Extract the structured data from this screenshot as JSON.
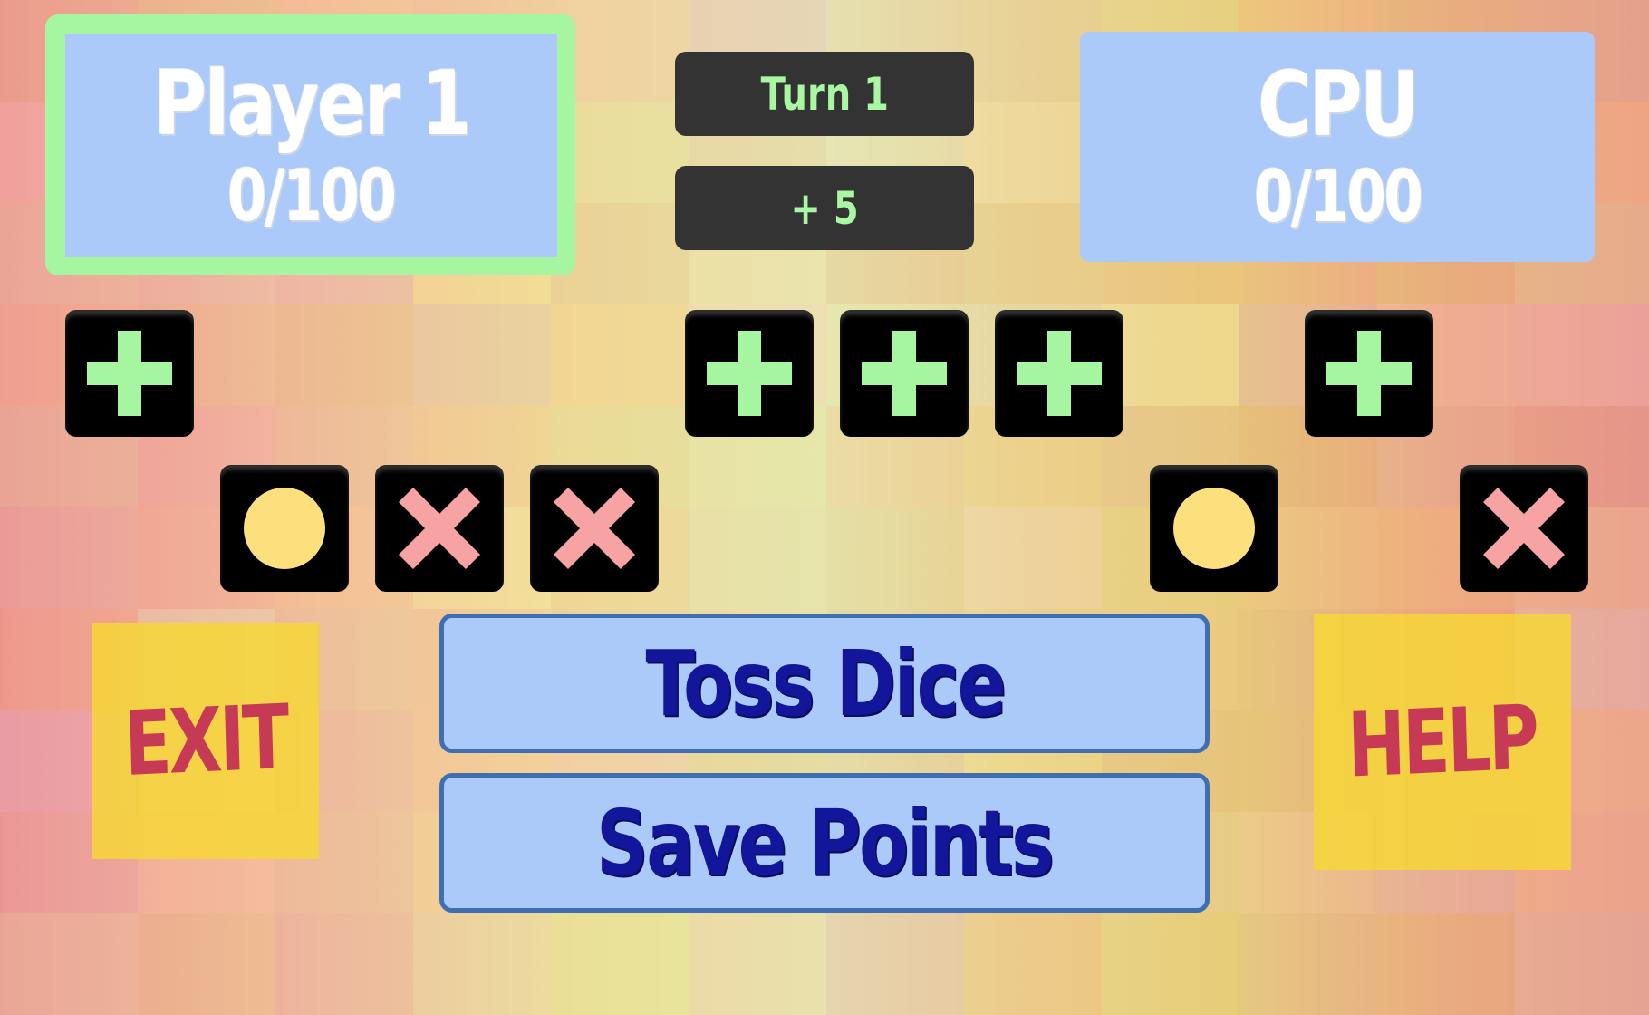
{
  "player": {
    "name": "Player 1",
    "score": "0/100",
    "active": true
  },
  "cpu": {
    "name": "CPU",
    "score": "0/100"
  },
  "turn_label": "Turn 1",
  "pending_points": "+ 5",
  "dice": [
    {
      "face": "plus",
      "row": "top"
    },
    {
      "face": "circle",
      "row": "bottom"
    },
    {
      "face": "cross",
      "row": "bottom"
    },
    {
      "face": "cross",
      "row": "bottom"
    },
    {
      "face": "plus",
      "row": "top"
    },
    {
      "face": "plus",
      "row": "top"
    },
    {
      "face": "plus",
      "row": "top"
    },
    {
      "face": "circle",
      "row": "bottom"
    },
    {
      "face": "plus",
      "row": "top"
    },
    {
      "face": "cross",
      "row": "bottom"
    }
  ],
  "buttons": {
    "exit": "EXIT",
    "help": "HELP",
    "toss": "Toss Dice",
    "save": "Save Points"
  },
  "colors": {
    "plus": "#a6f5a0",
    "circle": "#fde07e",
    "cross": "#f7a3a3",
    "panel": "#abcaf9",
    "active_border": "#a6f5a0",
    "info_text": "#a9f7a2",
    "button_text": "#12169a",
    "sticky": "#f6d637",
    "sticky_text": "#c63a55"
  }
}
